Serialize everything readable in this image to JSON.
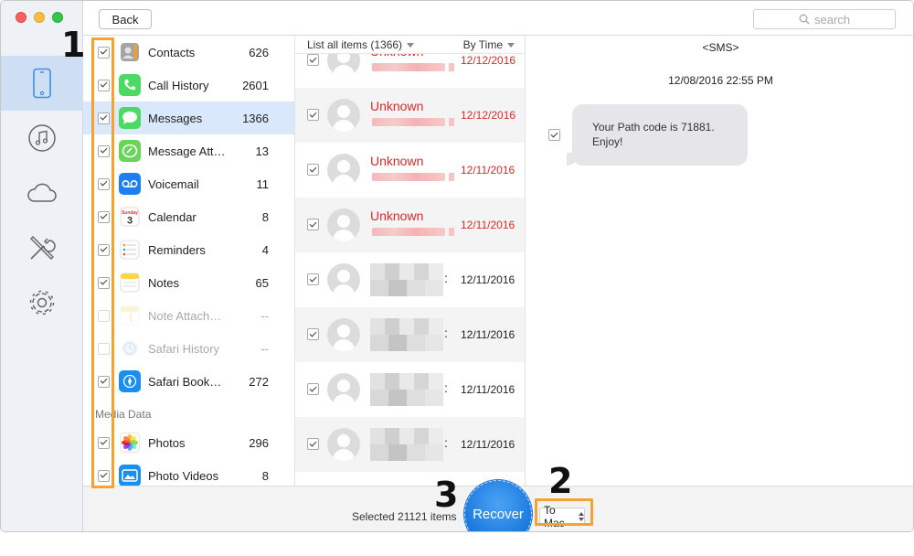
{
  "window": {
    "back_label": "Back",
    "search_placeholder": "search"
  },
  "rail": {
    "items": [
      "phone-icon",
      "music-icon",
      "cloud-icon",
      "tools-icon",
      "gear-icon"
    ],
    "active": "phone-icon"
  },
  "categories": [
    {
      "label": "Contacts",
      "count": "626",
      "checked": true,
      "dim": false,
      "icon": "contacts-icon",
      "color": "#8a8a8a"
    },
    {
      "label": "Call History",
      "count": "2601",
      "checked": true,
      "dim": false,
      "icon": "phone-call-icon",
      "color": "#4cd964"
    },
    {
      "label": "Messages",
      "count": "1366",
      "checked": true,
      "dim": false,
      "icon": "messages-icon",
      "color": "#4cd964",
      "selected": true
    },
    {
      "label": "Message Att…",
      "count": "13",
      "checked": true,
      "dim": false,
      "icon": "message-attachment-icon",
      "color": "#6ad45a"
    },
    {
      "label": "Voicemail",
      "count": "11",
      "checked": true,
      "dim": false,
      "icon": "voicemail-icon",
      "color": "#1e7ff0"
    },
    {
      "label": "Calendar",
      "count": "8",
      "checked": true,
      "dim": false,
      "icon": "calendar-icon",
      "color": "#ffffff"
    },
    {
      "label": "Reminders",
      "count": "4",
      "checked": true,
      "dim": false,
      "icon": "reminders-icon",
      "color": "#f2f2f2"
    },
    {
      "label": "Notes",
      "count": "65",
      "checked": true,
      "dim": false,
      "icon": "notes-icon",
      "color": "#fbd54a"
    },
    {
      "label": "Note Attach…",
      "count": "--",
      "checked": false,
      "dim": true,
      "icon": "note-attachment-icon",
      "color": "#f6e7a6"
    },
    {
      "label": "Safari History",
      "count": "--",
      "checked": false,
      "dim": true,
      "icon": "safari-history-icon",
      "color": "#cfe1f5"
    },
    {
      "label": "Safari Book…",
      "count": "272",
      "checked": true,
      "dim": false,
      "icon": "safari-bookmark-icon",
      "color": "#1a8ff0"
    }
  ],
  "media_section": {
    "label": "Media Data"
  },
  "media": [
    {
      "label": "Photos",
      "count": "296",
      "checked": true,
      "icon": "photos-icon"
    },
    {
      "label": "Photo Videos",
      "count": "8",
      "checked": true,
      "icon": "photo-videos-icon",
      "color": "#1a8ff0"
    }
  ],
  "message_list": {
    "header_left": "List all items (1366)",
    "header_right": "By Time",
    "rows": [
      {
        "name": "Unknown",
        "date": "12/12/2016",
        "red": true
      },
      {
        "name": "Unknown",
        "date": "12/12/2016",
        "red": true
      },
      {
        "name": "Unknown",
        "date": "12/11/2016",
        "red": true
      },
      {
        "name": "Unknown",
        "date": "12/11/2016",
        "red": true
      },
      {
        "name": "",
        "date": "12/11/2016",
        "red": false
      },
      {
        "name": "",
        "date": "12/11/2016",
        "red": false
      },
      {
        "name": "",
        "date": "12/11/2016",
        "red": false
      },
      {
        "name": "",
        "date": "12/11/2016",
        "red": false
      }
    ]
  },
  "detail": {
    "title": "<SMS>",
    "timestamp": "12/08/2016 22:55 PM",
    "message": "Your Path code is 71881. Enjoy!"
  },
  "bottom": {
    "selected_text": "Selected 21121 items",
    "recover_label": "Recover",
    "destination": "To Mac"
  },
  "annotations": {
    "step1": "1",
    "step2": "2",
    "step3": "3",
    "color": "#f5a233"
  }
}
